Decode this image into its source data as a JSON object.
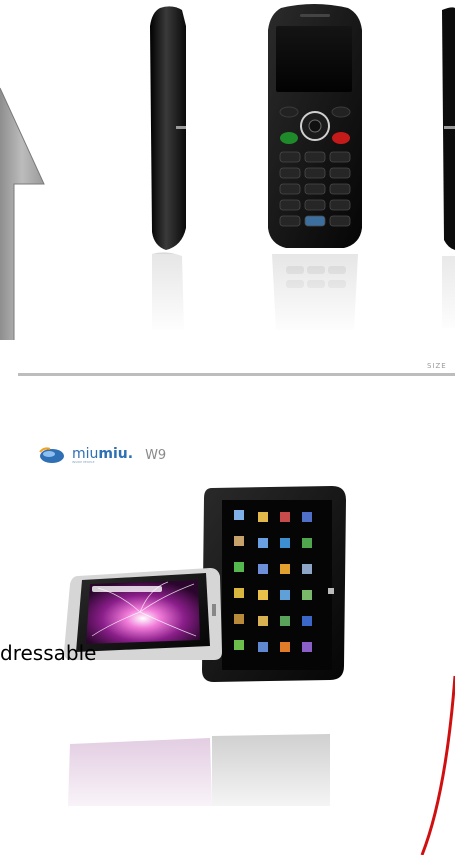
{
  "page": {
    "size_label": "SIZE",
    "brand": {
      "name_part1": "miu",
      "name_part2": "miu.",
      "tagline": "INSIDE PEOPLE",
      "model": "W9"
    },
    "overlay_text": "dressable"
  },
  "colors": {
    "arrow": "#a9a9a9",
    "brand_blue": "#2f6fb4",
    "phone_body": "#1a1a1a",
    "accent_red": "#d01010"
  },
  "icons": [
    "arrow-up-icon",
    "brand-logo-icon"
  ]
}
